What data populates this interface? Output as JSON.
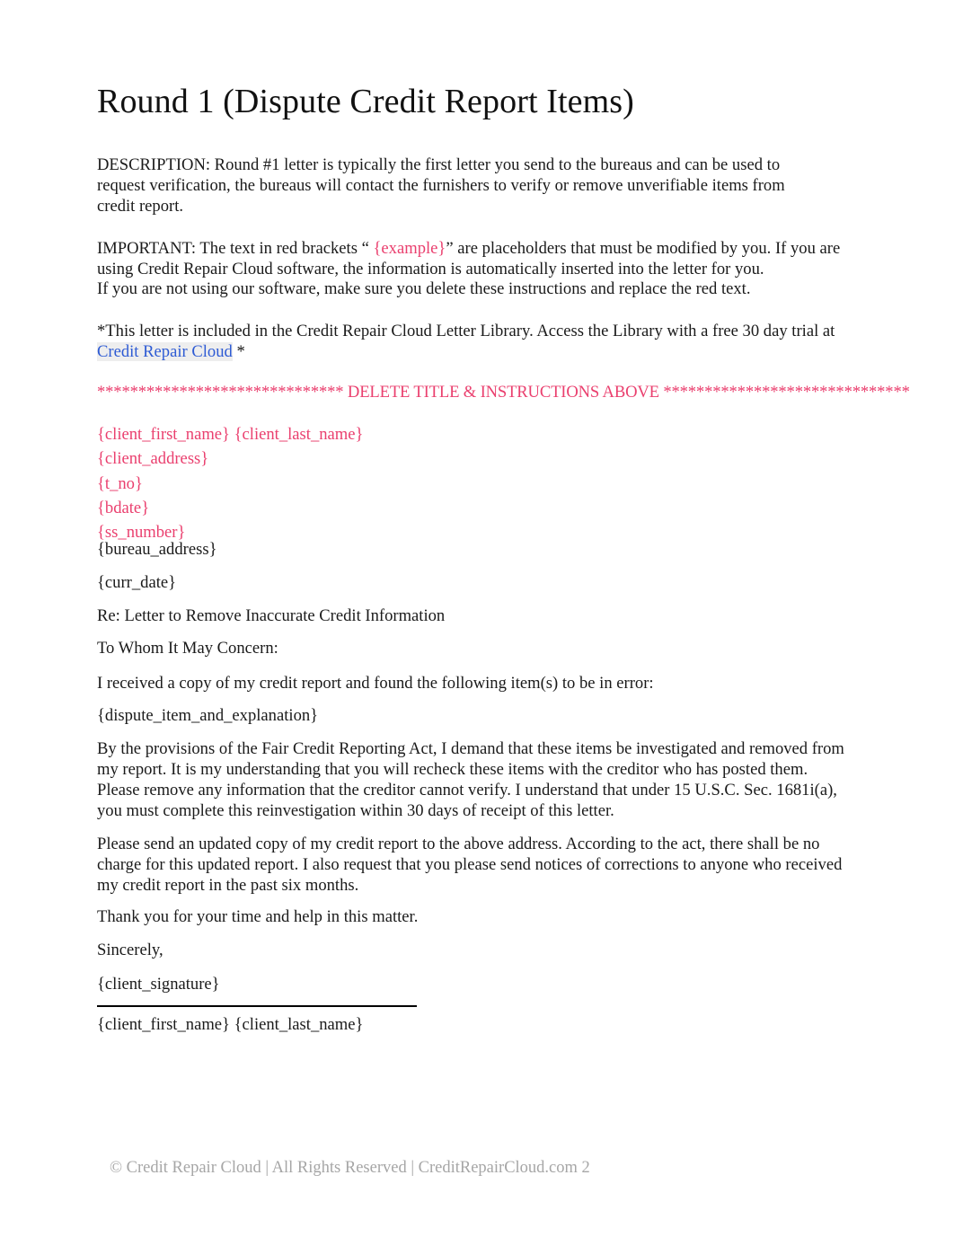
{
  "document": {
    "title": "Round 1 (Dispute Credit Report Items)",
    "paragraphs": {
      "description": "DESCRIPTION: Round #1 letter is typically the first letter you send to the bureaus and can be used to request verification, the bureaus will contact the furnishers to verify or remove unverifiable items from credit report.",
      "important_part1": "IMPORTANT:  The text in red brackets “   ",
      "important_placeholder": "{example}",
      "important_part2": "” are placeholders that must be modified by you. If you are using Credit Repair Cloud software, the information is automatically inserted into the letter for you.",
      "important_line3": "If you are not using our software, make sure you delete these instructions and replace the red text.",
      "library_part1": "*This letter is included in the Credit Repair Cloud Letter Library. Access the Library with a free 30 day trial at ",
      "library_link": "Credit Repair Cloud",
      "library_part2": "   *"
    },
    "delete_banner": {
      "stars_left": "******************************",
      "label": " DELETE TITLE & INSTRUCTIONS ABOVE ",
      "stars_right": "******************************"
    },
    "client_block": [
      "{client_first_name} {client_last_name}",
      "{client_address}",
      "{t_no}",
      "{bdate}",
      "{ss_number}"
    ],
    "bureau_address": "{bureau_address}",
    "curr_date": "{curr_date}",
    "subject_line": "Re: Letter to Remove Inaccurate Credit Information",
    "salutation": "To Whom It May Concern:",
    "body": {
      "intro": "I received a copy of my credit report and found the following item(s) to be in error:",
      "dispute_placeholder": "{dispute_item_and_explanation}",
      "fcra_paragraph": "By the provisions of the Fair Credit Reporting Act, I demand that these items be investigated and removed from my report. It is my understanding that you will recheck these items with the creditor who has posted them. Please remove any information that the creditor cannot verify. I understand that under 15 U.S.C. Sec. 1681i(a), you must complete this reinvestigation within 30 days of receipt of this letter.",
      "updated_copy_paragraph": "Please send an updated copy of my credit report to the above address. According to the act, there shall be no charge for this updated report. I also request that you please send notices of corrections to anyone who received my credit report in the past six months.",
      "thank_you": "Thank you for your time and help in this matter.",
      "closing": "Sincerely,"
    },
    "signature": {
      "signature_placeholder": "{client_signature}",
      "name_placeholder": "{client_first_name} {client_last_name}"
    },
    "footer": "© Credit Repair Cloud | All Rights Reserved | CreditRepairCloud.com 2"
  },
  "colors": {
    "placeholder_pink": "#ea3f6e",
    "link_blue": "#2e5bd4",
    "footer_gray": "#a6a6a6",
    "body_text": "#1a1a1a"
  }
}
